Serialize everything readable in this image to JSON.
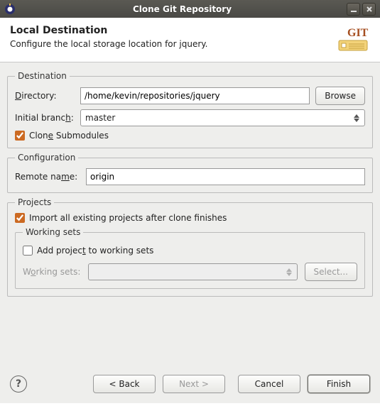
{
  "window": {
    "title": "Clone Git Repository"
  },
  "header": {
    "title": "Local Destination",
    "subtitle": "Configure the local storage location for jquery.",
    "icon_text": "GIT"
  },
  "destination": {
    "legend": "Destination",
    "directory_label": "Directory:",
    "directory_value": "/home/kevin/repositories/jquery",
    "browse_label": "Browse",
    "initial_branch_label": "Initial branch:",
    "initial_branch_value": "master",
    "clone_submodules_label": "Clone Submodules",
    "clone_submodules_checked": true
  },
  "configuration": {
    "legend": "Configuration",
    "remote_name_label": "Remote name:",
    "remote_name_value": "origin"
  },
  "projects": {
    "legend": "Projects",
    "import_label": "Import all existing projects after clone finishes",
    "import_checked": true,
    "working_sets_legend": "Working sets",
    "add_to_ws_label": "Add project to working sets",
    "add_to_ws_checked": false,
    "ws_label": "Working sets:",
    "ws_value": "",
    "select_label": "Select..."
  },
  "footer": {
    "back": "< Back",
    "next": "Next >",
    "cancel": "Cancel",
    "finish": "Finish"
  }
}
